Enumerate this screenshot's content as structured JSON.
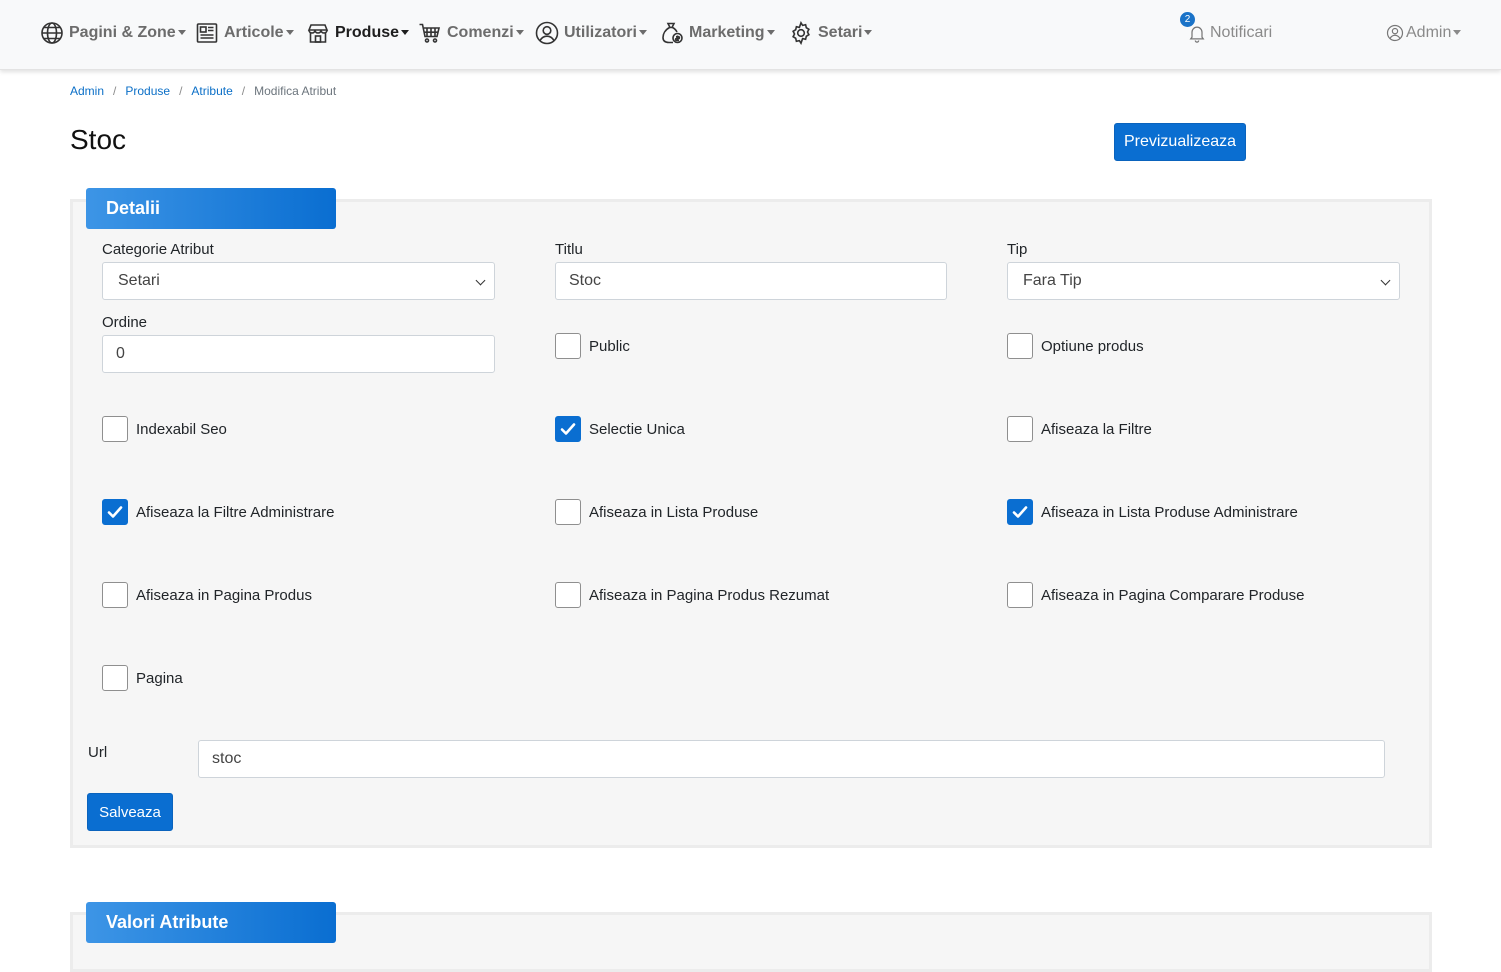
{
  "nav": {
    "items": [
      {
        "label": "Pagini & Zone",
        "icon": "globe-icon"
      },
      {
        "label": "Articole",
        "icon": "newspaper-icon"
      },
      {
        "label": "Produse",
        "icon": "store-icon"
      },
      {
        "label": "Comenzi",
        "icon": "cart-icon"
      },
      {
        "label": "Utilizatori",
        "icon": "user-circle-icon"
      },
      {
        "label": "Marketing",
        "icon": "money-bag-icon"
      },
      {
        "label": "Setari",
        "icon": "gear-icon"
      }
    ],
    "notifications_label": "Notificari",
    "notifications_count": "2",
    "admin_label": "Admin"
  },
  "breadcrumb": {
    "items": [
      "Admin",
      "Produse",
      "Atribute"
    ],
    "current": "Modifica Atribut"
  },
  "page": {
    "title": "Stoc",
    "preview_label": "Previzualizeaza"
  },
  "details": {
    "tab_label": "Detalii",
    "category_label": "Categorie Atribut",
    "category_value": "Setari",
    "title_label": "Titlu",
    "title_value": "Stoc",
    "type_label": "Tip",
    "type_value": "Fara Tip",
    "order_label": "Ordine",
    "order_value": "0",
    "checkboxes": [
      {
        "label": "Public",
        "checked": false
      },
      {
        "label": "Optiune produs",
        "checked": false
      },
      {
        "label": "Indexabil Seo",
        "checked": false
      },
      {
        "label": "Selectie Unica",
        "checked": true
      },
      {
        "label": "Afiseaza la Filtre",
        "checked": false
      },
      {
        "label": "Afiseaza la Filtre Administrare",
        "checked": true
      },
      {
        "label": "Afiseaza in Lista Produse",
        "checked": false
      },
      {
        "label": "Afiseaza in Lista Produse Administrare",
        "checked": true
      },
      {
        "label": "Afiseaza in Pagina Produs",
        "checked": false
      },
      {
        "label": "Afiseaza in Pagina Produs Rezumat",
        "checked": false
      },
      {
        "label": "Afiseaza in Pagina Comparare Produse",
        "checked": false
      },
      {
        "label": "Pagina",
        "checked": false
      }
    ],
    "url_label": "Url",
    "url_value": "stoc",
    "save_label": "Salveaza"
  },
  "values_section": {
    "tab_label": "Valori Atribute"
  },
  "colors": {
    "primary": "#0a6ed1",
    "nav_bg": "#f8f9fa",
    "card_bg": "#f6f6f6"
  }
}
